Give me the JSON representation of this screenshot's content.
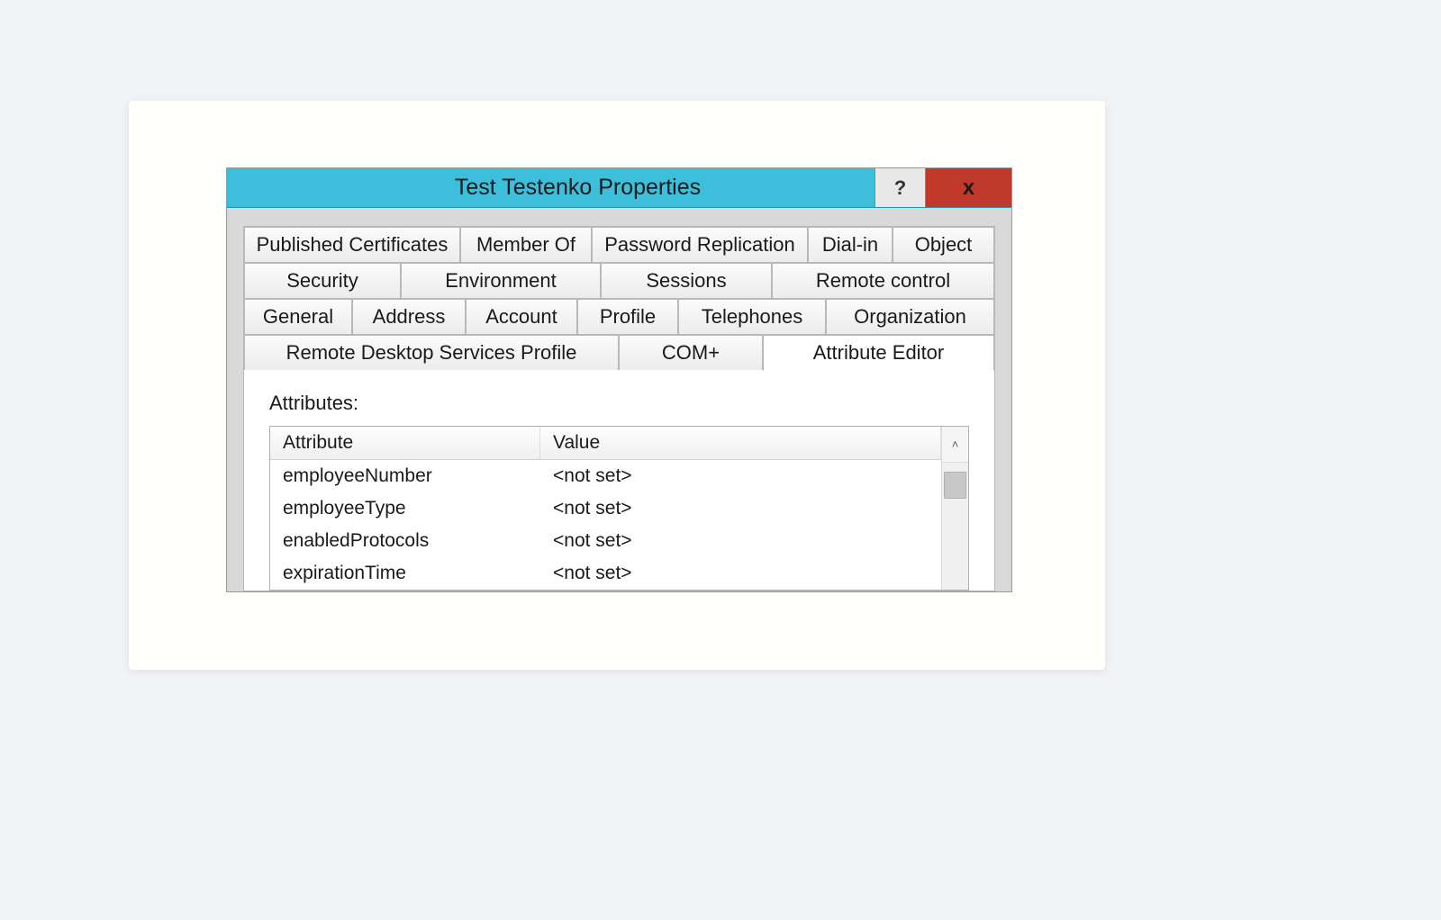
{
  "titlebar": {
    "title": "Test Testenko Properties",
    "help_label": "?",
    "close_label": "x"
  },
  "tabs": {
    "row1": [
      {
        "label": "Published Certificates"
      },
      {
        "label": "Member Of"
      },
      {
        "label": "Password Replication"
      },
      {
        "label": "Dial-in"
      },
      {
        "label": "Object"
      }
    ],
    "row2": [
      {
        "label": "Security"
      },
      {
        "label": "Environment"
      },
      {
        "label": "Sessions"
      },
      {
        "label": "Remote control"
      }
    ],
    "row3": [
      {
        "label": "General"
      },
      {
        "label": "Address"
      },
      {
        "label": "Account"
      },
      {
        "label": "Profile"
      },
      {
        "label": "Telephones"
      },
      {
        "label": "Organization"
      }
    ],
    "row4": [
      {
        "label": "Remote Desktop Services Profile"
      },
      {
        "label": "COM+"
      },
      {
        "label": "Attribute Editor",
        "active": true
      }
    ]
  },
  "content": {
    "attributes_label": "Attributes:",
    "columns": {
      "attribute": "Attribute",
      "value": "Value"
    },
    "rows": [
      {
        "attr": "employeeNumber",
        "val": "<not set>"
      },
      {
        "attr": "employeeType",
        "val": "<not set>"
      },
      {
        "attr": "enabledProtocols",
        "val": "<not set>"
      },
      {
        "attr": "expirationTime",
        "val": "<not set>"
      }
    ]
  },
  "scrollbar": {
    "up_glyph": "˄"
  }
}
